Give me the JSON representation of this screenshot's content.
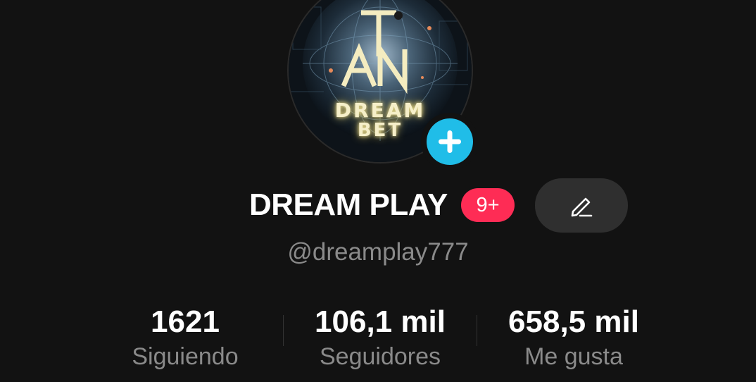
{
  "profile": {
    "logo_line1": "DREAM",
    "logo_line2": "BET",
    "add_icon": "plus-icon",
    "name": "DREAM PLAY",
    "notification_badge": "9+",
    "edit_icon": "pencil-icon",
    "handle": "@dreamplay777"
  },
  "stats": {
    "following": {
      "value": "1621",
      "label": "Siguiendo"
    },
    "followers": {
      "value": "106,1 mil",
      "label": "Seguidores"
    },
    "likes": {
      "value": "658,5 mil",
      "label": "Me gusta"
    }
  },
  "colors": {
    "background": "#121212",
    "add_button": "#20bde8",
    "badge": "#fe2c55",
    "edit_button": "#2f2f2f",
    "secondary_text": "#8a8a8a"
  }
}
